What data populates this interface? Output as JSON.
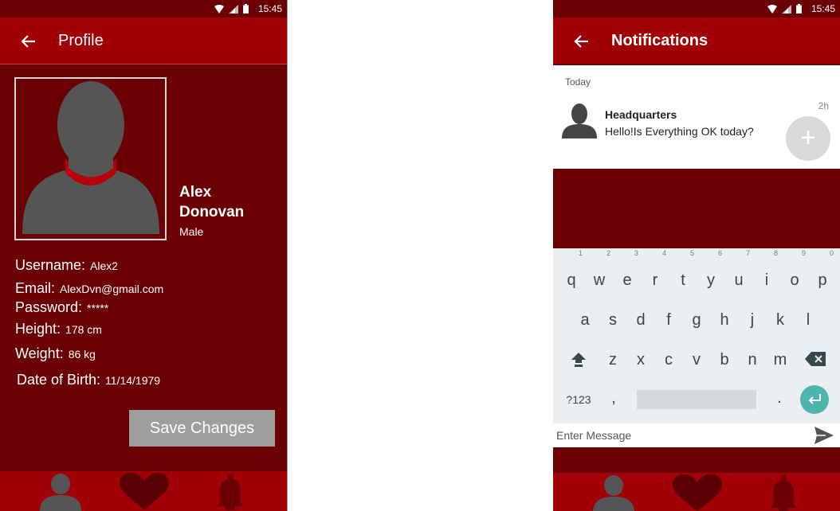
{
  "colors": {
    "primary_dark": "#6b0004",
    "primary": "#a00006",
    "nav_icon": "#3a0a0a",
    "accent": "#4db6ac",
    "button_gray": "#9e9e9e"
  },
  "status_bar": {
    "time": "15:45",
    "icons": [
      "wifi-icon",
      "signal-icon",
      "battery-icon"
    ]
  },
  "profile_screen": {
    "title": "Profile",
    "first_name": "Alex",
    "last_name": "Donovan",
    "gender": "Male",
    "fields": [
      {
        "label": "Username:",
        "value": "Alex2"
      },
      {
        "label": "Email:",
        "value": "AlexDvn@gmail.com"
      },
      {
        "label": "Password:",
        "value": "*****"
      },
      {
        "label": "Height:",
        "value": "178 cm"
      },
      {
        "label": "Weight:",
        "value": "86 kg"
      },
      {
        "label": "Date of Birth:",
        "value": "11/14/1979"
      }
    ],
    "save_label": "Save Changes",
    "nav_items": [
      "profile-nav-icon",
      "favorites-heart-icon",
      "notifications-bell-icon"
    ]
  },
  "notifications_screen": {
    "title": "Notifications",
    "section": "Today",
    "items": [
      {
        "sender": "Headquarters",
        "message": "Hello!Is Everything OK today?",
        "time": "2h"
      }
    ],
    "fab_label": "+",
    "keyboard": {
      "row1": [
        "q",
        "w",
        "e",
        "r",
        "t",
        "y",
        "u",
        "i",
        "o",
        "p"
      ],
      "row1_hints": [
        "1",
        "2",
        "3",
        "4",
        "5",
        "6",
        "7",
        "8",
        "9",
        "0"
      ],
      "row2": [
        "a",
        "s",
        "d",
        "f",
        "g",
        "h",
        "j",
        "k",
        "l"
      ],
      "row3": [
        "z",
        "x",
        "c",
        "v",
        "b",
        "n",
        "m"
      ],
      "symbols_key": "?123",
      "comma_key": ",",
      "period_key": "."
    },
    "message_placeholder": "Enter Message"
  }
}
